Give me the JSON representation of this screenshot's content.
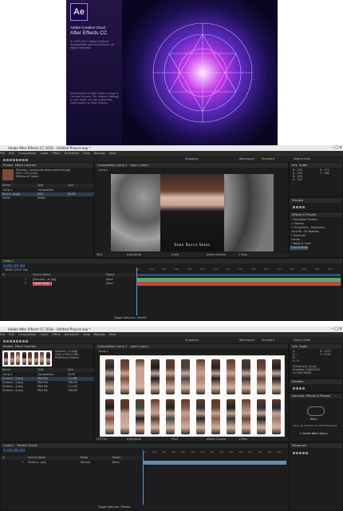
{
  "splash": {
    "logo": "Ae",
    "line1": "Adobe Creative Cloud",
    "line2": "After Effects CC",
    "legal": "© 1993-2017 Adobe Systems Incorporated and its licensors. All rights reserved.",
    "artwork": "Illustrazione di Nitish Roshi e Jorge R. Canedo Estrada. Per ulteriori dettagli e note legali, vai alla schermata Informazioni su After Effects."
  },
  "win1": {
    "title": "Adobe After Effects CC 2018 - Untitled Project.aep *",
    "menus": [
      "File",
      "Edit",
      "Composition",
      "Layer",
      "Effect",
      "Animation",
      "View",
      "Window",
      "Help"
    ],
    "workspace_label": "Workspace",
    "workspace_value": "Standard",
    "snapping": "Snapping",
    "search": "Search Help",
    "project_tab": "Project",
    "effect_controls_tab": "Effect Controls",
    "footage_name": "Dorcasis...(sense.not-lomp mumrivet.jpg)",
    "footage_size": "345 x 720 (1.00)",
    "footage_colors": "Millions of Colors",
    "proj_cols": [
      "Name",
      "Type",
      "Size"
    ],
    "proj_rows": [
      {
        "name": "Comp 1",
        "type": "Composition",
        "size": ""
      },
      {
        "name": "Dorca...at.jpg",
        "type": "JPEG",
        "size": "86 KB"
      },
      {
        "name": "Solids",
        "type": "Folder",
        "size": ""
      }
    ],
    "comp_tab": "Composition Comp 1",
    "layer_tab": "Layer (none)",
    "comp_subtab": "Comp 1",
    "watermark": "Sean Rocco Salon",
    "zoom": "50%",
    "timecode_view": "0;00;00;00",
    "resolution": "(Half)",
    "camera": "Active Camera",
    "views": "1 View",
    "info_tab": "Info",
    "audio_tab": "Audio",
    "info_values": [
      "R : 239",
      "G : 239",
      "B : 239",
      "A : 255"
    ],
    "info_xy": [
      "X : 772",
      "Y : 756"
    ],
    "preview_tab": "Preview",
    "effects_tab": "Effects & Presets",
    "effects_items": [
      "* Animation Presets",
      "  > Presets",
      "  > Transitions - Movement",
      "    Card Wi...2D Rotation",
      "* Generate",
      "    Fractal",
      "* Noise & Grain",
      "    Fractal Noise"
    ],
    "timeline_tab": "Comp 1",
    "timeline_time": "0;00;00;00",
    "timeline_fps": "00000 (29.97 fps)",
    "layer_cols": [
      "#",
      "Source Name",
      "Parent"
    ],
    "layers": [
      {
        "num": "1",
        "name": "[Dorcasis...at.jpg]",
        "parent": "None"
      },
      {
        "name": "Fractal Noise 1",
        "num": "2",
        "parent": "None"
      }
    ],
    "ruler": [
      "0s",
      "02s",
      "04s",
      "06s",
      "08s",
      "10s",
      "12s",
      "14s",
      "16s",
      "18s",
      "20s",
      "22s",
      "24s",
      "26s",
      "28s",
      "30s"
    ],
    "toggle": "Toggle Switches / Modes"
  },
  "win2": {
    "title": "Adobe After Effects CC 2018 - Untitled Project.aep *",
    "menus": [
      "File",
      "Edit",
      "Composition",
      "Layer",
      "Effect",
      "Animation",
      "View",
      "Window",
      "Help"
    ],
    "workspace_label": "Workspace",
    "workspace_value": "Standard",
    "snapping": "Snapping",
    "search": "Search Help",
    "project_tab": "Project",
    "effect_controls_tab": "Effect Controls",
    "footage_name": "Screens...(1.png)",
    "footage_size": "1152 x 594 (1.00)",
    "footage_colors": "Millions of Colors+",
    "proj_cols": [
      "Name",
      "Type",
      "Size"
    ],
    "proj_rows": [
      {
        "name": "Comp 1",
        "type": "Composition",
        "size": "29.97"
      },
      {
        "name": "Screens...1.png",
        "type": "PNG file",
        "size": "1.2 MB"
      },
      {
        "name": "Screens...2.png",
        "type": "PNG file",
        "size": "796 KB"
      },
      {
        "name": "Screens...3.png",
        "type": "PNG file",
        "size": "711 KB"
      },
      {
        "name": "Screens...4.png",
        "type": "PNG file",
        "size": "336 KB"
      }
    ],
    "comp_tab": "Composition Comp 1",
    "layer_tab": "Layer (none)",
    "comp_subtab": "Comp 1",
    "zoom": "(15.7%)",
    "timecode_view": "0;00;00;00",
    "resolution": "(Full)",
    "camera": "Active Camera",
    "views": "1 View",
    "info_tab": "Info",
    "audio_tab": "Audio",
    "info_values": [
      "R :",
      "G :",
      "B :",
      "A : 0"
    ],
    "info_xy": [
      "X : 2272",
      "Y : 2176"
    ],
    "info_extra": [
      "Screenshot_3.png",
      "Duration: 0;00;05;00",
      "In: 0;00;00;00"
    ],
    "preview_tab": "Preview",
    "libraries_tab": "Libraries",
    "effects_tab": "Effects & Presets",
    "retry": "Retry",
    "sorry": "Sorry, we couldn't connect to the server",
    "create_library": "+ Create New Library",
    "paragraph_tab": "Paragraph",
    "timeline_tab": "Comp 1",
    "render_queue_tab": "Render Queue",
    "timeline_time": "0;00;00;00",
    "layer_cols": [
      "#",
      "Source Name",
      "Mode",
      "Parent"
    ],
    "layers": [
      {
        "num": "1",
        "name": "Screens...png",
        "mode": "Normal",
        "parent": "None"
      }
    ],
    "ruler": [
      "0s",
      "02s",
      "04s",
      "06s",
      "08s",
      "10s",
      "12s",
      "14s",
      "16s",
      "18s",
      "20s",
      "22s",
      "24s",
      "26s",
      "28s"
    ],
    "toggle": "Toggle Switches / Modes"
  },
  "colors": {
    "accent": "#4f9cff",
    "timeline_green": "#5fa765",
    "timeline_red": "#b84a4a",
    "purple": "#9a7dfd"
  }
}
